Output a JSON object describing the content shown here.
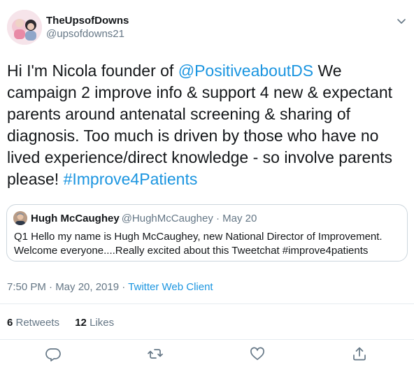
{
  "user": {
    "display_name": "TheUpsofDowns",
    "handle": "@upsofdowns21"
  },
  "tweet": {
    "text_before": "Hi I'm Nicola founder of ",
    "mention": "@PositiveaboutDS",
    "text_after": "  We campaign 2 improve info & support 4 new & expectant parents around antenatal screening & sharing of diagnosis.  Too much is driven by those who have no lived experience/direct knowledge - so involve parents please! ",
    "hashtag": "#Improve4Patients"
  },
  "quoted": {
    "name": "Hugh McCaughey",
    "handle": "@HughMcCaughey · May 20",
    "text": "Q1 Hello my name is Hugh McCaughey, new National Director of Improvement. Welcome everyone....Really excited about this Tweetchat #improve4patients"
  },
  "meta": {
    "time": "7:50 PM · May 20, 2019 · ",
    "client": "Twitter Web Client"
  },
  "stats": {
    "retweets_count": "6",
    "retweets_label": " Retweets",
    "likes_count": "12",
    "likes_label": " Likes"
  },
  "icons": {
    "menu": "chevron-down-icon",
    "reply": "reply-icon",
    "retweet": "retweet-icon",
    "like": "heart-icon",
    "share": "share-icon"
  },
  "colors": {
    "link": "#1b95e0",
    "muted": "#657786",
    "border": "#e6ecf0"
  }
}
